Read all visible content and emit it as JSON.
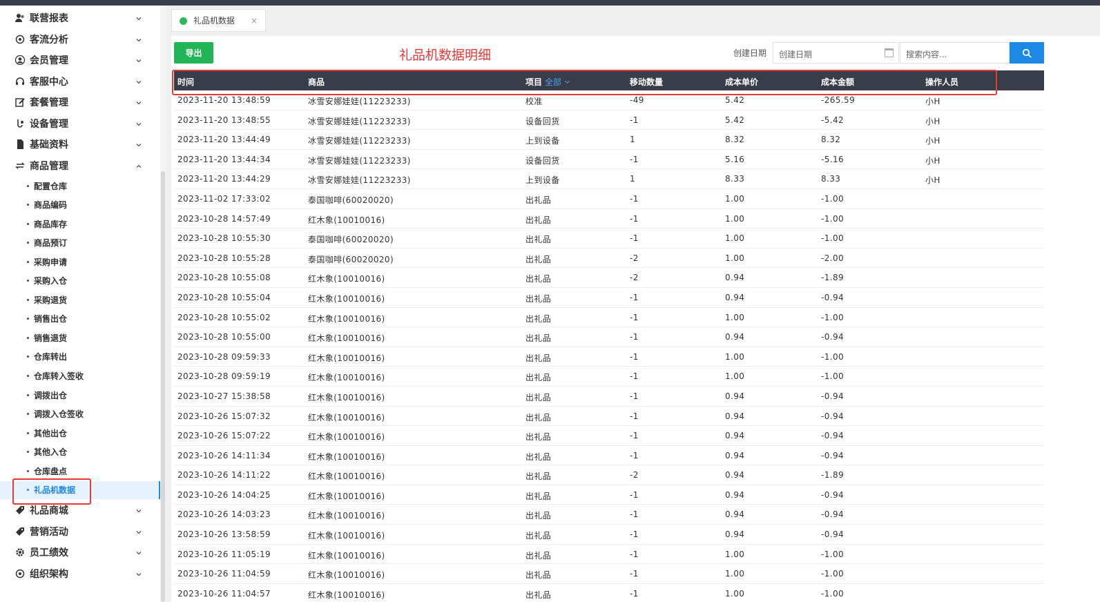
{
  "sidebar": {
    "groups_top": [
      {
        "label": "联营报表",
        "icon": "users-icon"
      },
      {
        "label": "客流分析",
        "icon": "target-icon"
      },
      {
        "label": "会员管理",
        "icon": "user-icon"
      },
      {
        "label": "客服中心",
        "icon": "headset-icon"
      },
      {
        "label": "套餐管理",
        "icon": "edit-icon"
      },
      {
        "label": "设备管理",
        "icon": "device-icon"
      },
      {
        "label": "基础资料",
        "icon": "file-icon"
      },
      {
        "label": "商品管理",
        "icon": "swap-icon"
      }
    ],
    "sub_items": [
      "配置仓库",
      "商品编码",
      "商品库存",
      "商品预订",
      "采购申请",
      "采购入仓",
      "采购退货",
      "销售出仓",
      "销售退货",
      "仓库转出",
      "仓库转入签收",
      "调拨出仓",
      "调拨入仓签收",
      "其他出仓",
      "其他入仓",
      "仓库盘点",
      "礼品机数据"
    ],
    "groups_bottom": [
      {
        "label": "礼品商城",
        "icon": "tag-icon"
      },
      {
        "label": "营销活动",
        "icon": "tag-icon"
      },
      {
        "label": "员工绩效",
        "icon": "gear-icon"
      },
      {
        "label": "组织架构",
        "icon": "target-icon"
      }
    ]
  },
  "tab": {
    "label": "礼品机数据",
    "close": "×"
  },
  "toolbar": {
    "export_label": "导出",
    "heading": "礼品机数据明细",
    "date_label": "创建日期",
    "date_placeholder": "创建日期",
    "search_placeholder": "搜索内容..."
  },
  "table": {
    "columns": [
      "时间",
      "商品",
      "项目",
      "移动数量",
      "成本单价",
      "成本金额",
      "操作人员"
    ],
    "project_filter": "全部",
    "rows": [
      [
        "2023-11-20 13:48:59",
        "冰雪安娜娃娃(11223233)",
        "校准",
        "-49",
        "5.42",
        "-265.59",
        "小H"
      ],
      [
        "2023-11-20 13:48:55",
        "冰雪安娜娃娃(11223233)",
        "设备回货",
        "-1",
        "5.42",
        "-5.42",
        "小H"
      ],
      [
        "2023-11-20 13:44:49",
        "冰雪安娜娃娃(11223233)",
        "上到设备",
        "1",
        "8.32",
        "8.32",
        "小H"
      ],
      [
        "2023-11-20 13:44:34",
        "冰雪安娜娃娃(11223233)",
        "设备回货",
        "-1",
        "5.16",
        "-5.16",
        "小H"
      ],
      [
        "2023-11-20 13:44:29",
        "冰雪安娜娃娃(11223233)",
        "上到设备",
        "1",
        "8.33",
        "8.33",
        "小H"
      ],
      [
        "2023-11-02 17:33:02",
        "泰国咖啡(60020020)",
        "出礼品",
        "-1",
        "1.00",
        "-1.00",
        ""
      ],
      [
        "2023-10-28 14:57:49",
        "红木象(10010016)",
        "出礼品",
        "-1",
        "1.00",
        "-1.00",
        ""
      ],
      [
        "2023-10-28 10:55:30",
        "泰国咖啡(60020020)",
        "出礼品",
        "-1",
        "1.00",
        "-1.00",
        ""
      ],
      [
        "2023-10-28 10:55:28",
        "泰国咖啡(60020020)",
        "出礼品",
        "-2",
        "1.00",
        "-2.00",
        ""
      ],
      [
        "2023-10-28 10:55:08",
        "红木象(10010016)",
        "出礼品",
        "-2",
        "0.94",
        "-1.89",
        ""
      ],
      [
        "2023-10-28 10:55:04",
        "红木象(10010016)",
        "出礼品",
        "-1",
        "0.94",
        "-0.94",
        ""
      ],
      [
        "2023-10-28 10:55:02",
        "红木象(10010016)",
        "出礼品",
        "-1",
        "1.00",
        "-1.00",
        ""
      ],
      [
        "2023-10-28 10:55:00",
        "红木象(10010016)",
        "出礼品",
        "-1",
        "0.94",
        "-0.94",
        ""
      ],
      [
        "2023-10-28 09:59:33",
        "红木象(10010016)",
        "出礼品",
        "-1",
        "1.00",
        "-1.00",
        ""
      ],
      [
        "2023-10-28 09:59:19",
        "红木象(10010016)",
        "出礼品",
        "-1",
        "1.00",
        "-1.00",
        ""
      ],
      [
        "2023-10-27 15:38:58",
        "红木象(10010016)",
        "出礼品",
        "-1",
        "0.94",
        "-0.94",
        ""
      ],
      [
        "2023-10-26 15:07:32",
        "红木象(10010016)",
        "出礼品",
        "-1",
        "0.94",
        "-0.94",
        ""
      ],
      [
        "2023-10-26 15:07:22",
        "红木象(10010016)",
        "出礼品",
        "-1",
        "0.94",
        "-0.94",
        ""
      ],
      [
        "2023-10-26 14:11:34",
        "红木象(10010016)",
        "出礼品",
        "-1",
        "0.94",
        "-0.94",
        ""
      ],
      [
        "2023-10-26 14:11:22",
        "红木象(10010016)",
        "出礼品",
        "-2",
        "0.94",
        "-1.89",
        ""
      ],
      [
        "2023-10-26 14:04:25",
        "红木象(10010016)",
        "出礼品",
        "-1",
        "0.94",
        "-0.94",
        ""
      ],
      [
        "2023-10-26 14:03:23",
        "红木象(10010016)",
        "出礼品",
        "-1",
        "0.94",
        "-0.94",
        ""
      ],
      [
        "2023-10-26 13:58:59",
        "红木象(10010016)",
        "出礼品",
        "-1",
        "0.94",
        "-0.94",
        ""
      ],
      [
        "2023-10-26 11:05:19",
        "红木象(10010016)",
        "出礼品",
        "-1",
        "1.00",
        "-1.00",
        ""
      ],
      [
        "2023-10-26 11:04:59",
        "红木象(10010016)",
        "出礼品",
        "-1",
        "1.00",
        "-1.00",
        ""
      ],
      [
        "2023-10-26 11:04:57",
        "红木象(10010016)",
        "出礼品",
        "-1",
        "1.00",
        "-1.00",
        ""
      ]
    ]
  },
  "colors": {
    "topbar": "#393d49",
    "table_header": "#393d49",
    "export_button": "#21b558",
    "search_button": "#1e88e5",
    "heading": "#e53935",
    "active_item": "#1e88e5",
    "highlight_box": "#e53935"
  }
}
